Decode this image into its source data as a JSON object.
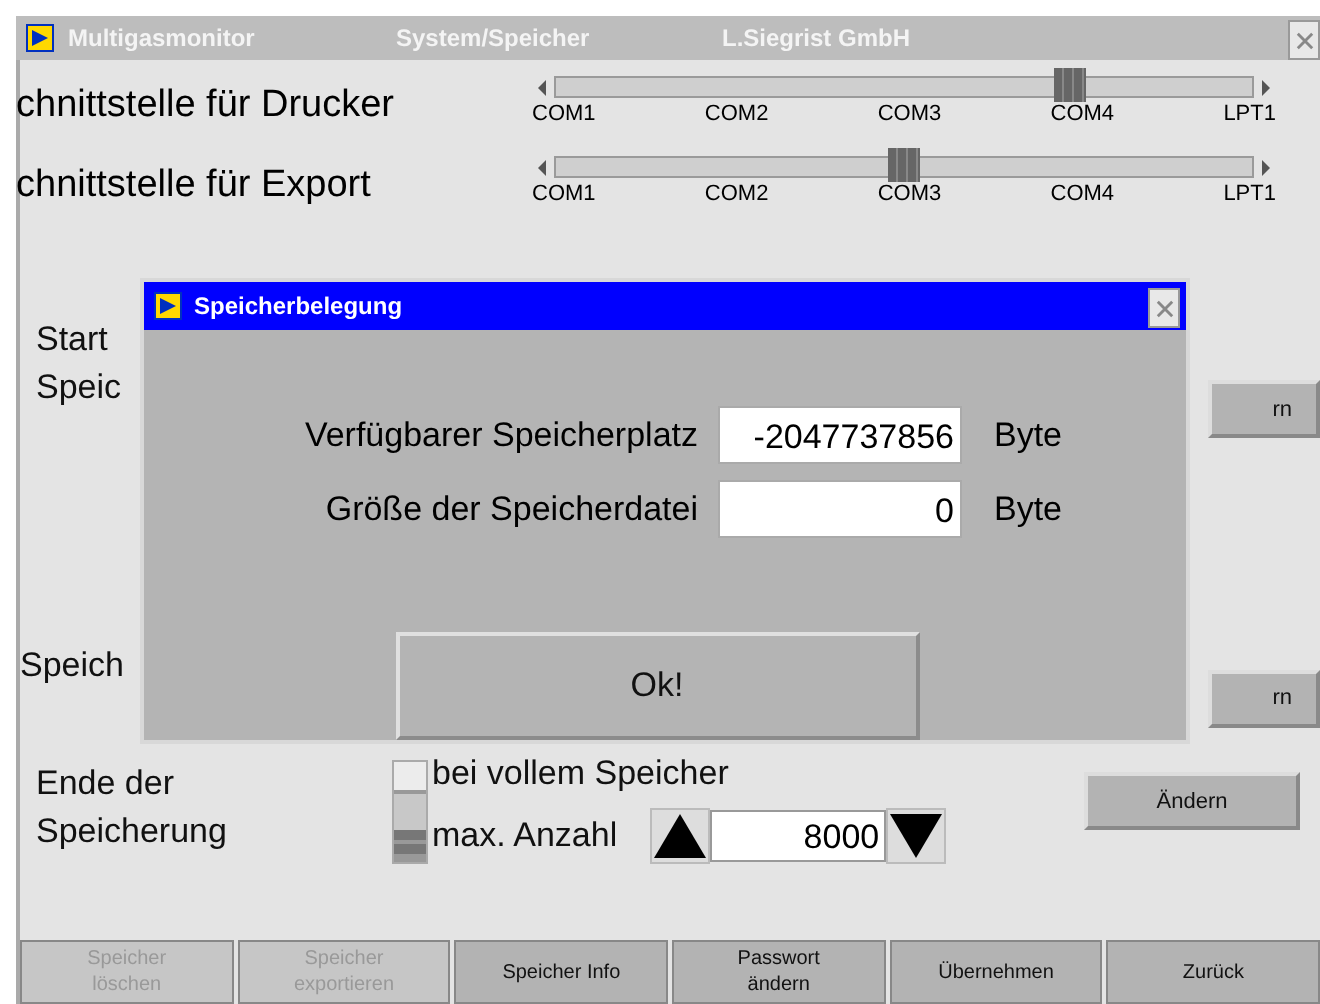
{
  "window": {
    "title_parts": [
      "Multigasmonitor",
      "System/Speicher",
      "L.Siegrist GmbH"
    ]
  },
  "ports": [
    {
      "label": "chnittstelle für Drucker",
      "level": 0.75,
      "ticks": [
        "COM1",
        "COM2",
        "COM3",
        "COM4",
        "LPT1"
      ]
    },
    {
      "label": "chnittstelle für Export",
      "level": 0.5,
      "ticks": [
        "COM1",
        "COM2",
        "COM3",
        "COM4",
        "LPT1"
      ]
    }
  ],
  "start_section": {
    "label_lines": [
      "Start",
      "Speic"
    ],
    "button": "rn"
  },
  "storage_section": {
    "label": "Speich",
    "button": "rn"
  },
  "end_section": {
    "label": "Ende der Speicherung",
    "options": [
      {
        "label": "bei vollem Speicher",
        "selected": false
      },
      {
        "label": "max. Anzahl",
        "selected": true
      }
    ],
    "count": "8000",
    "button": "Ändern"
  },
  "footer_buttons": [
    {
      "label": "Speicher löschen",
      "disabled": true
    },
    {
      "label": "Speicher exportieren",
      "disabled": true
    },
    {
      "label": "Speicher Info",
      "disabled": false
    },
    {
      "label": "Passwort ändern",
      "disabled": false
    },
    {
      "label": "Übernehmen",
      "disabled": false
    },
    {
      "label": "Zurück",
      "disabled": false
    }
  ],
  "dialog": {
    "title": "Speicherbelegung",
    "rows": [
      {
        "label": "Verfügbarer Speicherplatz",
        "value": "-2047737856",
        "unit": "Byte"
      },
      {
        "label": "Größe der Speicherdatei",
        "value": "0",
        "unit": "Byte"
      }
    ],
    "button": "Ok!"
  }
}
